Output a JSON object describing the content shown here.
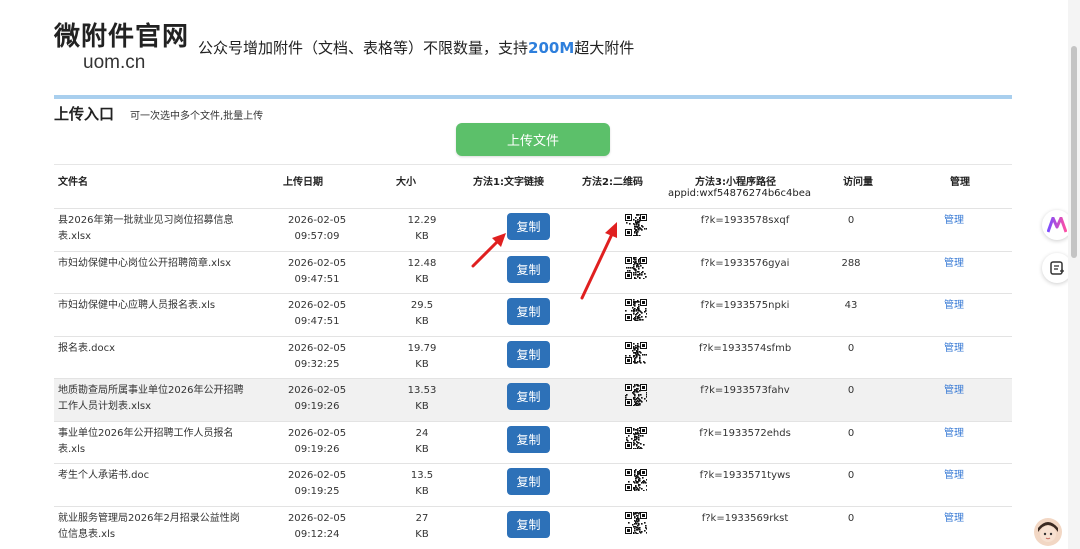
{
  "header": {
    "brand_title": "微附件官网",
    "brand_domain": "uom.cn",
    "tagline_before": "公众号增加附件（文档、表格等）不限数量，支持",
    "tagline_highlight": "200M",
    "tagline_after": "超大附件"
  },
  "upload": {
    "title": "上传入口",
    "hint": "可一次选中多个文件,批量上传",
    "button_label": "上传文件"
  },
  "table": {
    "columns": {
      "name": "文件名",
      "date": "上传日期",
      "size": "大小",
      "method1": "方法1:文字链接",
      "method2": "方法2:二维码",
      "method3": "方法3:小程序路径",
      "appid": "appid:wxf54876274b6c4bea",
      "views": "访问量",
      "manage": "管理"
    },
    "copy_label": "复制",
    "manage_label": "管理",
    "rows": [
      {
        "name": "县2026年第一批就业见习岗位招募信息表.xlsx",
        "date": "2026-02-05",
        "time": "09:57:09",
        "size": "12.29",
        "unit": "KB",
        "code": "f?k=1933578sxqf",
        "views": "0"
      },
      {
        "name": "市妇幼保健中心岗位公开招聘简章.xlsx",
        "date": "2026-02-05",
        "time": "09:47:51",
        "size": "12.48",
        "unit": "KB",
        "code": "f?k=1933576gyai",
        "views": "288"
      },
      {
        "name": "市妇幼保健中心应聘人员报名表.xls",
        "date": "2026-02-05",
        "time": "09:47:51",
        "size": "29.5",
        "unit": "KB",
        "code": "f?k=1933575npki",
        "views": "43"
      },
      {
        "name": "报名表.docx",
        "date": "2026-02-05",
        "time": "09:32:25",
        "size": "19.79",
        "unit": "KB",
        "code": "f?k=1933574sfmb",
        "views": "0"
      },
      {
        "name": "地质勘查局所属事业单位2026年公开招聘工作人员计划表.xlsx",
        "date": "2026-02-05",
        "time": "09:19:26",
        "size": "13.53",
        "unit": "KB",
        "code": "f?k=1933573fahv",
        "views": "0"
      },
      {
        "name": "事业单位2026年公开招聘工作人员报名表.xls",
        "date": "2026-02-05",
        "time": "09:19:26",
        "size": "24",
        "unit": "KB",
        "code": "f?k=1933572ehds",
        "views": "0"
      },
      {
        "name": "考生个人承诺书.doc",
        "date": "2026-02-05",
        "time": "09:19:25",
        "size": "13.5",
        "unit": "KB",
        "code": "f?k=1933571tyws",
        "views": "0"
      },
      {
        "name": "就业服务管理局2026年2月招录公益性岗位信息表.xls",
        "date": "2026-02-05",
        "time": "09:12:24",
        "size": "27",
        "unit": "KB",
        "code": "f?k=1933569rkst",
        "views": "0"
      }
    ]
  },
  "colors": {
    "accent_blue": "#2d71b8",
    "upload_green": "#5cc06a",
    "highlight_blue": "#2e7fdc",
    "annotation_red": "#e02020"
  },
  "icons": [
    "qr-code-icon",
    "ai-assistant-icon",
    "note-icon",
    "red-arrow-annotation",
    "user-avatar"
  ]
}
